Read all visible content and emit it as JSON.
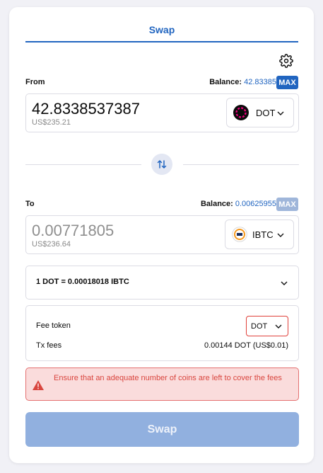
{
  "tabs": {
    "swap": "Swap"
  },
  "colors": {
    "accent": "#2165c0",
    "max_active": "#2165c0",
    "max_disabled": "#9fb6da",
    "error": "#d9463f",
    "button_disabled": "#91b0df"
  },
  "icons": {
    "settings": "gear-icon",
    "switch": "swap-arrows-icon",
    "chevron": "chevron-down-icon",
    "warning": "warning-icon",
    "dot": "polkadot-icon",
    "ibtc": "interbtc-icon"
  },
  "from": {
    "label": "From",
    "balance_label": "Balance:",
    "balance_value": "42.83385",
    "max_label": "MAX",
    "amount": "42.8338537387",
    "usd": "US$235.21",
    "token": "DOT"
  },
  "to": {
    "label": "To",
    "balance_label": "Balance:",
    "balance_value": "0.00625955",
    "max_label": "MAX",
    "amount": "0.00771805",
    "usd": "US$236.64",
    "token": "IBTC"
  },
  "rate": {
    "text": "1 DOT = 0.00018018 IBTC"
  },
  "fees": {
    "fee_token_label": "Fee token",
    "fee_token_value": "DOT",
    "tx_fees_label": "Tx fees",
    "tx_fees_value": "0.00144 DOT (US$0.01)"
  },
  "warning": {
    "text": "Ensure that an adequate number of coins are left to cover the fees"
  },
  "submit": {
    "label": "Swap"
  }
}
